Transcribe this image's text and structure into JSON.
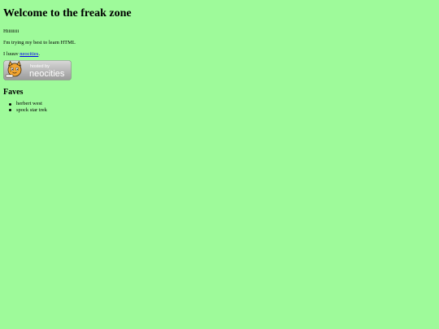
{
  "heading": "Welcome to the freak zone",
  "paragraphs": {
    "greeting": "Hiiiiiiii",
    "learning": "I'm trying my best to learn HTML",
    "love_prefix": "I luuuv ",
    "love_link": "neocities",
    "love_suffix": "."
  },
  "badge": {
    "text_small": "hosted by",
    "text_large": "neocities",
    "icon": "neocities-cat-icon"
  },
  "faves": {
    "title": "Faves",
    "items": [
      "herbert west",
      "spock star trek"
    ]
  },
  "colors": {
    "background": "#9efa9a",
    "link": "#0000ee"
  }
}
